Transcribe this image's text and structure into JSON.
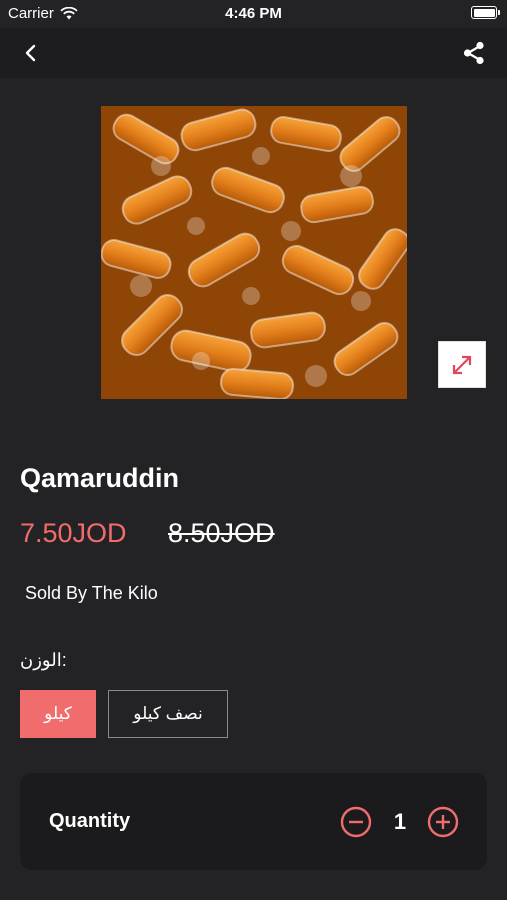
{
  "status": {
    "carrier": "Carrier",
    "time": "4:46 PM"
  },
  "nav": {
    "back_icon": "chevron-left-icon",
    "share_icon": "share-icon"
  },
  "product": {
    "name": "Qamaruddin",
    "price": "7.50JOD",
    "old_price": "8.50JOD",
    "description": "Sold By The Kilo",
    "image_alt": "wrapped orange apricot candies",
    "expand_icon": "expand-icon"
  },
  "weight": {
    "label": ":الوزن",
    "options": [
      {
        "label": "كيلو",
        "selected": true
      },
      {
        "label": "نصف كيلو",
        "selected": false
      }
    ]
  },
  "quantity": {
    "label": "Quantity",
    "value": "1"
  },
  "colors": {
    "accent": "#f16c6c",
    "background": "#232325",
    "card": "#1b1b1d"
  }
}
